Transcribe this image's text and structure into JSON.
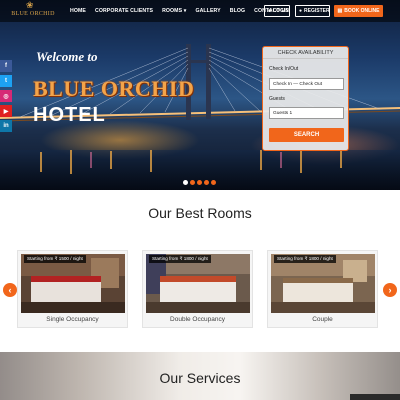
{
  "nav": {
    "logo_text": "BLUE ORCHID",
    "menu": [
      "HOME",
      "CORPORATE CLIENTS",
      "ROOMS",
      "GALLERY",
      "BLOG",
      "CONTACT US"
    ],
    "rooms_caret": "▾",
    "login_label": "LOGIN",
    "register_label": "REGISTER",
    "book_label": "BOOK ONLINE"
  },
  "social": [
    "facebook-icon",
    "twitter-icon",
    "instagram-icon",
    "youtube-icon",
    "linkedin-icon"
  ],
  "social_glyphs": [
    "f",
    "t",
    "◎",
    "▶",
    "in"
  ],
  "social_colors": [
    "#3b5998",
    "#1da1f2",
    "#d62976",
    "#e02020",
    "#0e76a8"
  ],
  "hero": {
    "welcome": "Welcome to",
    "brand": "BLUE ORCHID",
    "hotel": "HOTEL",
    "slides": 5,
    "active_slide": 0
  },
  "availability": {
    "title": "CHECK AVAILABILITY",
    "checkin_label": "Check In/Out",
    "checkin_value": "Check In  —  Check Out",
    "guests_label": "Guests",
    "guests_value": "Guests 1",
    "search_label": "SEARCH"
  },
  "rooms": {
    "title": "Our Best Rooms",
    "items": [
      {
        "name": "Single Occupancy",
        "price": "Starting from ₹ 1500 / night"
      },
      {
        "name": "Double Occupancy",
        "price": "Starting from ₹ 1800 / night"
      },
      {
        "name": "Couple",
        "price": "Starting from ₹ 1800 / night"
      }
    ],
    "prev_glyph": "‹",
    "next_glyph": "›"
  },
  "services": {
    "title": "Our Services"
  },
  "colors": {
    "accent": "#f1661b",
    "brand_gold": "#f3a44a"
  }
}
